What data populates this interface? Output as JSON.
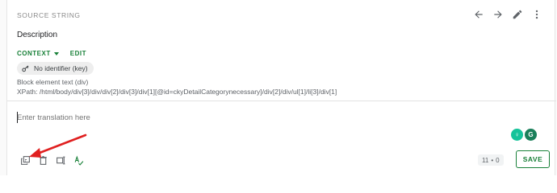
{
  "source": {
    "section_label": "SOURCE STRING",
    "description": "Description",
    "context_label": "CONTEXT",
    "edit_label": "EDIT",
    "identifier_chip": "No identifier (key)",
    "block_type": "Block element text (div)",
    "xpath": "XPath: /html/body/div[3]/div/div[2]/div[3]/div[1][@id=ckyDetailCategorynecessary]/div[2]/div/ul[1]/li[3]/div[1]"
  },
  "top_actions": [
    "arrow-left-icon",
    "arrow-right-icon",
    "pencil-icon",
    "more-vert-icon"
  ],
  "translation": {
    "placeholder": "Enter translation here",
    "value": ""
  },
  "extensions": {
    "badge1": "♀",
    "badge2": "G"
  },
  "toolbar": {
    "tools": [
      "copy-source-icon",
      "delete-icon",
      "insert-tag-icon",
      "spellcheck-icon"
    ],
    "counter_value": "11",
    "counter_sep": "•",
    "counter_value2": "0",
    "save_label": "SAVE"
  },
  "colors": {
    "accent": "#188038",
    "annotation_arrow": "#e02020"
  }
}
